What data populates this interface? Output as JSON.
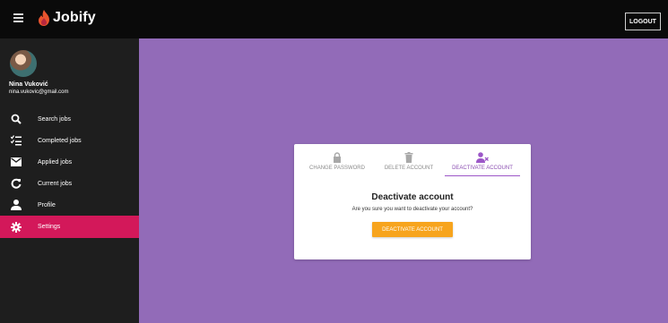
{
  "app": {
    "name": "Jobify",
    "logout_label": "LOGOUT"
  },
  "colors": {
    "accent": "#d3185a",
    "background": "#926bb8",
    "button": "#f7a41d",
    "tab_active": "#9c57c8"
  },
  "user": {
    "name": "Nina Vuković",
    "email": "nina.vukovic@gmail.com"
  },
  "sidebar": {
    "items": [
      {
        "label": "Search jobs",
        "icon": "search-icon"
      },
      {
        "label": "Completed jobs",
        "icon": "checklist-icon"
      },
      {
        "label": "Applied jobs",
        "icon": "mail-icon"
      },
      {
        "label": "Current jobs",
        "icon": "refresh-icon"
      },
      {
        "label": "Profile",
        "icon": "person-icon"
      },
      {
        "label": "Settings",
        "icon": "gear-icon",
        "active": true
      }
    ]
  },
  "settings": {
    "tabs": [
      {
        "label": "CHANGE PASSWORD",
        "icon": "lock-icon"
      },
      {
        "label": "DELETE ACCOUNT",
        "icon": "trash-icon"
      },
      {
        "label": "DEACTIVATE ACCOUNT",
        "icon": "person-remove-icon",
        "active": true
      }
    ],
    "title": "Deactivate account",
    "subtitle": "Are you sure you want to deactivate your account?",
    "button_label": "DEACTIVATE ACCOUNT"
  }
}
